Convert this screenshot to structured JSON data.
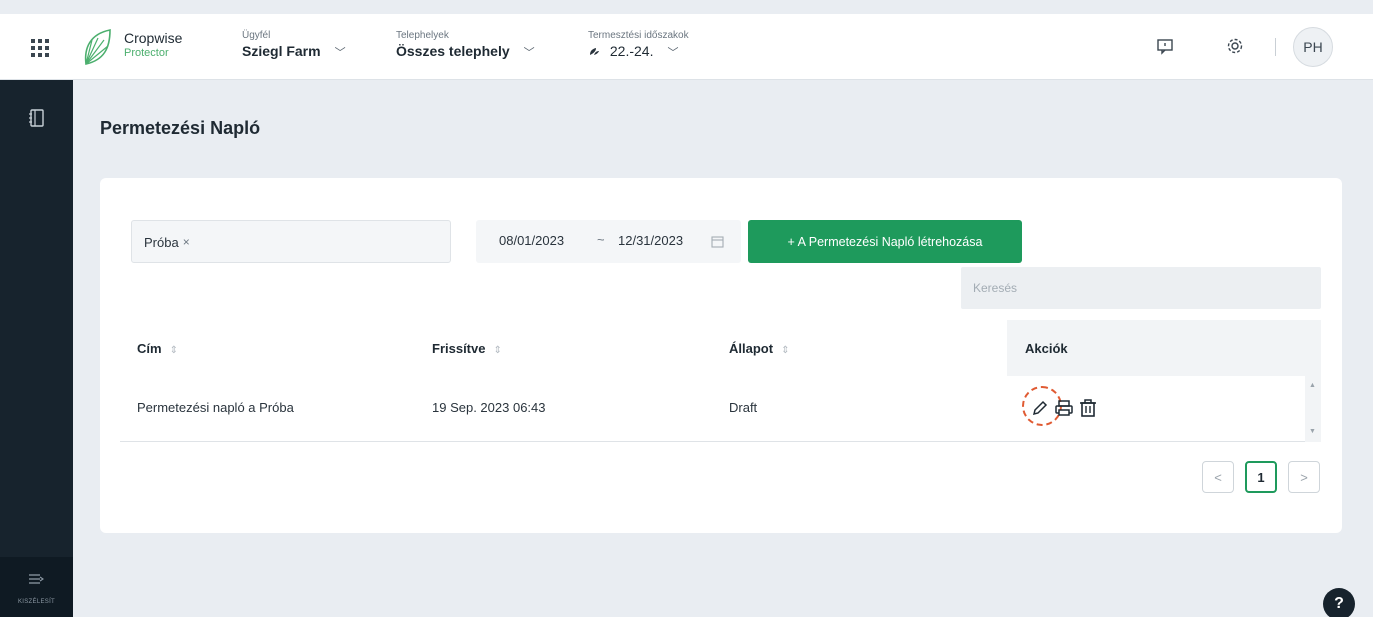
{
  "header": {
    "brand_name": "Cropwise",
    "brand_sub": "Protector",
    "client_label": "Ügyfél",
    "client_value": "Sziegl Farm",
    "sites_label": "Telephelyek",
    "sites_value": "Összes telephely",
    "season_label": "Termesztési időszakok",
    "season_value": "22.-24.",
    "avatar_initials": "PH"
  },
  "sidebar": {
    "collapse_label": "KISZÉLESÍT"
  },
  "page": {
    "title": "Permetezési Napló"
  },
  "filters": {
    "tag_label": "Próba",
    "tag_remove": "×",
    "date_from": "08/01/2023",
    "date_sep": "~",
    "date_to": "12/31/2023",
    "create_button": "+ A Permetezési Napló létrehozása",
    "search_placeholder": "Keresés"
  },
  "table": {
    "columns": [
      "Cím",
      "Frissítve",
      "Állapot",
      "Akciók"
    ],
    "sort_glyph": "⇕",
    "rows": [
      {
        "title": "Permetezési napló a Próba",
        "updated": "19 Sep. 2023 06:43",
        "status": "Draft"
      }
    ]
  },
  "pagination": {
    "prev": "<",
    "current": "1",
    "next": ">"
  },
  "help": "?",
  "colors": {
    "accent_green": "#1e9a5c",
    "sidebar_dark": "#17232d",
    "highlight": "#e05a32"
  }
}
